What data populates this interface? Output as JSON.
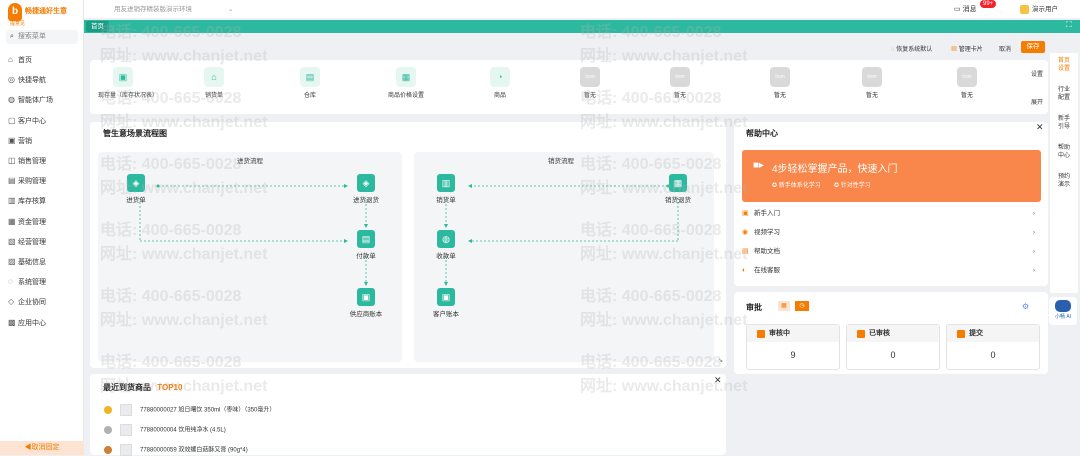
{
  "brand": {
    "name": "畅捷通好生意",
    "sub": "提意见"
  },
  "sidebar": {
    "search_placeholder": "搜索菜单",
    "items": [
      {
        "label": "首页",
        "icon": "home-icon"
      },
      {
        "label": "快捷导航",
        "icon": "shortcut-icon"
      },
      {
        "label": "智能体广场",
        "icon": "agent-icon"
      },
      {
        "label": "客户中心",
        "icon": "customer-icon"
      },
      {
        "label": "营销",
        "icon": "marketing-icon"
      },
      {
        "label": "销售管理",
        "icon": "sales-icon"
      },
      {
        "label": "采购管理",
        "icon": "purchase-icon"
      },
      {
        "label": "库存核算",
        "icon": "inventory-icon"
      },
      {
        "label": "资金管理",
        "icon": "funds-icon"
      },
      {
        "label": "经营管理",
        "icon": "operation-icon"
      },
      {
        "label": "基础信息",
        "icon": "base-info-icon"
      },
      {
        "label": "系统管理",
        "icon": "system-icon"
      },
      {
        "label": "企业协同",
        "icon": "collab-icon"
      },
      {
        "label": "应用中心",
        "icon": "app-center-icon"
      }
    ],
    "unpin": "◀取消固定"
  },
  "topbar": {
    "breadcrumb": "用友进销存精装版演示环境",
    "messages": "消息",
    "badge": "99+",
    "user": "演示用户"
  },
  "tabs": {
    "home": "首页",
    "expand_icon": "expand-icon"
  },
  "watermark": {
    "phone": "电话: 400-665-0028",
    "site": "网址: www.chanjet.net"
  },
  "toolbar": {
    "restore": "恢复系统默认",
    "manage": "管理卡片",
    "cancel": "取消",
    "save": "保存"
  },
  "quick": {
    "items": [
      {
        "label": "现存量（库存状况表）",
        "icon": "stock-icon"
      },
      {
        "label": "销货单",
        "icon": "store-icon"
      },
      {
        "label": "仓库",
        "icon": "warehouse-icon"
      },
      {
        "label": "商品价格设置",
        "icon": "price-grid-icon"
      },
      {
        "label": "商品",
        "icon": "product-icon"
      },
      {
        "label": "暂无",
        "icon": "placeholder-icon"
      },
      {
        "label": "暂无",
        "icon": "placeholder-icon"
      },
      {
        "label": "暂无",
        "icon": "placeholder-icon"
      },
      {
        "label": "暂无",
        "icon": "placeholder-icon"
      },
      {
        "label": "暂无",
        "icon": "placeholder-icon"
      }
    ],
    "icon_text": "Icon",
    "settings": "设置",
    "expand": "展开"
  },
  "rightnav": [
    "首页\n设置",
    "行业\n配置",
    "新手\n引导",
    "帮助\n中心",
    "预约\n演示"
  ],
  "flow": {
    "title": "管生意场景流程图",
    "purchase": "进货流程",
    "sales": "销货流程",
    "nodes": {
      "p1": "进货单",
      "p2": "进货退货",
      "p3": "付款单",
      "p4": "供应商账本",
      "s1": "销货单",
      "s2": "销货退货",
      "s3": "收款单",
      "s4": "客户账本"
    }
  },
  "help": {
    "title": "帮助中心",
    "banner": "4步轻松掌握产品，快速入门",
    "tag1": "新手体系化学习",
    "tag2": "针对性学习",
    "rows": [
      "新手入门",
      "视频学习",
      "帮助文档",
      "在线客服"
    ]
  },
  "approval": {
    "title": "审批",
    "boxes": [
      {
        "label": "审核中",
        "value": "9"
      },
      {
        "label": "已审核",
        "value": "0"
      },
      {
        "label": "提交",
        "value": "0"
      }
    ]
  },
  "recent": {
    "title": "最近到货商品",
    "top": "TOP10",
    "rows": [
      {
        "text": "77880000027 旭日曙饮 350ml（枣味）（350毫升）",
        "medal": "#f0b323"
      },
      {
        "text": "77880000004 饮用纯净水 (4.5L)",
        "medal": "#b0b0b0"
      },
      {
        "text": "77880000059 双效螺白菇酥又膏 (90g*4)",
        "medal": "#cd7f32"
      }
    ]
  },
  "robot": "小畅 AI"
}
